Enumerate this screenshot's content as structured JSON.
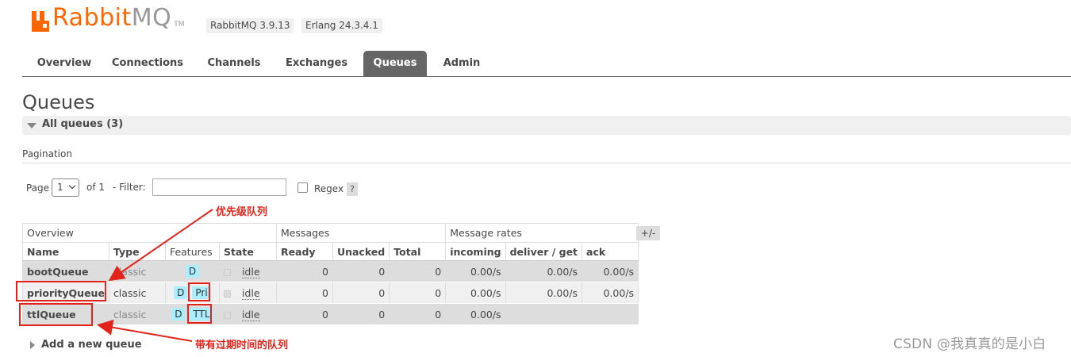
{
  "header": {
    "logo_rabbit": "Rabbit",
    "logo_mq": "MQ",
    "logo_tm": "TM",
    "rabbitmq_version": "RabbitMQ 3.9.13",
    "erlang_version": "Erlang 24.3.4.1"
  },
  "tabs": [
    {
      "label": "Overview",
      "active": false
    },
    {
      "label": "Connections",
      "active": false
    },
    {
      "label": "Channels",
      "active": false
    },
    {
      "label": "Exchanges",
      "active": false
    },
    {
      "label": "Queues",
      "active": true
    },
    {
      "label": "Admin",
      "active": false
    }
  ],
  "page": {
    "title": "Queues",
    "section_label": "All queues (3)",
    "pagination_label": "Pagination"
  },
  "controls": {
    "page_label": "Page",
    "page_value": "1",
    "of_label": "of 1",
    "filter_label": "- Filter:",
    "filter_value": "",
    "regex_label": "Regex",
    "regex_checked": false,
    "help_label": "?",
    "plusminus_label": "+/-"
  },
  "table": {
    "groups": [
      "Overview",
      "Messages",
      "Message rates"
    ],
    "columns": [
      "Name",
      "Type",
      "Features",
      "State",
      "Ready",
      "Unacked",
      "Total",
      "incoming",
      "deliver / get",
      "ack"
    ],
    "rows": [
      {
        "name": "bootQueue",
        "type": "classic",
        "features": [
          "D"
        ],
        "state": "idle",
        "ready": "0",
        "unacked": "0",
        "total": "0",
        "incoming": "0.00/s",
        "deliver_get": "0.00/s",
        "ack": "0.00/s"
      },
      {
        "name": "priorityQueue",
        "type": "classic",
        "features": [
          "D",
          "Pri"
        ],
        "state": "idle",
        "ready": "0",
        "unacked": "0",
        "total": "0",
        "incoming": "0.00/s",
        "deliver_get": "0.00/s",
        "ack": "0.00/s"
      },
      {
        "name": "ttlQueue",
        "type": "classic",
        "features": [
          "D",
          "TTL"
        ],
        "state": "idle",
        "ready": "0",
        "unacked": "0",
        "total": "0",
        "incoming": "0.00/s",
        "deliver_get": "",
        "ack": ""
      }
    ]
  },
  "add_queue_label": "Add a new queue",
  "annotations": {
    "priority_label": "优先级队列",
    "ttl_label": "带有过期时间的队列"
  },
  "watermark": "CSDN @我真真的是小白",
  "colors": {
    "brand_orange": "#ff6600",
    "active_tab": "#666666",
    "feature_badge": "#aaeeff",
    "annotation_red": "#e2231a"
  }
}
